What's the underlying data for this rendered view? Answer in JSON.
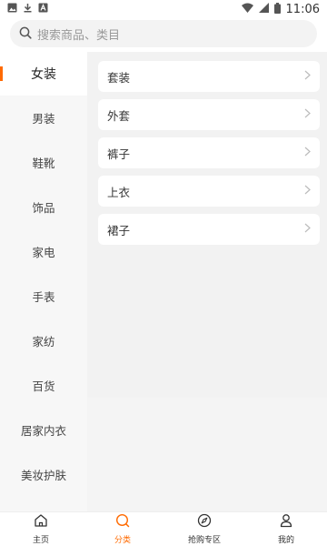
{
  "status": {
    "time": "11:06"
  },
  "search": {
    "placeholder": "搜索商品、类目"
  },
  "sidebar": {
    "items": [
      {
        "label": "女装"
      },
      {
        "label": "男装"
      },
      {
        "label": "鞋靴"
      },
      {
        "label": "饰品"
      },
      {
        "label": "家电"
      },
      {
        "label": "手表"
      },
      {
        "label": "家纺"
      },
      {
        "label": "百货"
      },
      {
        "label": "居家内衣"
      },
      {
        "label": "美妆护肤"
      }
    ]
  },
  "subcategories": [
    {
      "label": "套装"
    },
    {
      "label": "外套"
    },
    {
      "label": "裤子"
    },
    {
      "label": "上衣"
    },
    {
      "label": "裙子"
    }
  ],
  "tabs": [
    {
      "label": "主页",
      "icon": "home-icon"
    },
    {
      "label": "分类",
      "icon": "search-icon"
    },
    {
      "label": "抢购专区",
      "icon": "compass-icon"
    },
    {
      "label": "我的",
      "icon": "user-icon"
    }
  ],
  "accent_color": "#ff6a00"
}
